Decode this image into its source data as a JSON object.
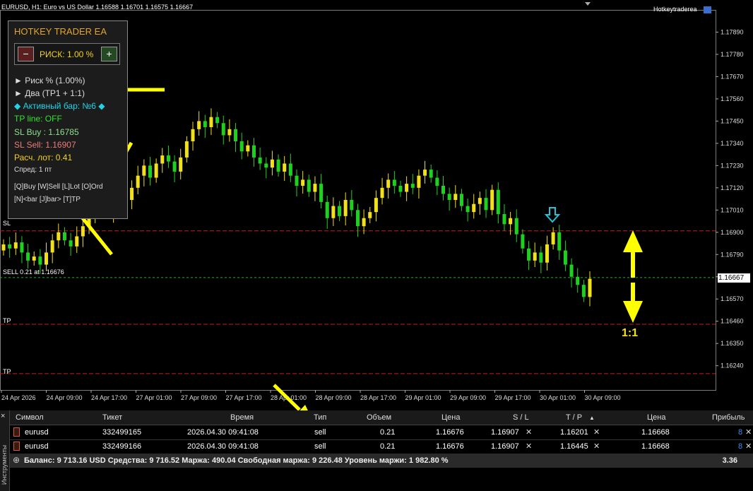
{
  "window": {
    "title": "EURUSD, H1:  Euro vs US Dollar  1.16588 1.16701 1.16575 1.16667",
    "ea_name": "Hotkeytraderea"
  },
  "ea_panel": {
    "title": "HOTKEY TRADER EA",
    "minus_label": "−",
    "plus_label": "+",
    "risk_label": "РИСК: 1.00 %",
    "risk_mode": "► Риск % (1.00%)",
    "tp_mode": "► Два (TP1 + 1:1)",
    "active_bar": "◆ Активный бар: №6 ◆",
    "tp_line": "TP line: OFF",
    "sl_buy": "SL Buy : 1.16785",
    "sl_sell": "SL Sell: 1.16907",
    "calc_lot": "Расч. лот: 0.41",
    "spread": "Спред: 1 пт",
    "hotkeys_1": "[Q]Buy  [W]Sell  [L]Lot  [O]Ord",
    "hotkeys_2": "[N]<bar  [J]bar>  [T]TP"
  },
  "chart_lines": {
    "sl_label": "SL",
    "sell_label": "SELL 0.21 at 1.16676",
    "tp1_label": "TP",
    "tp2_label": "TP",
    "current_price": "1.16667",
    "ratio_label": "1:1"
  },
  "colors": {
    "bull": "#f2e01b",
    "bear": "#1fd11f",
    "sl_line": "#c81e1e",
    "sell_line": "#1fb21f",
    "arrow": "#ffff00",
    "cyan_arrow": "#22c5d5",
    "accent_orange": "#e3a52b"
  },
  "terminal": {
    "close_icon": "×",
    "side_label": "Инструменты",
    "headers": [
      "Символ",
      "Тикет",
      "Время",
      "Тип",
      "Объем",
      "Цена",
      "S / L",
      "T / P",
      "Цена",
      "Прибыль"
    ],
    "sort_indicator": "▲",
    "rows": [
      {
        "symbol": "eurusd",
        "ticket": "332499165",
        "time": "2026.04.30 09:41:08",
        "type": "sell",
        "volume": "0.21",
        "price": "1.16676",
        "sl": "1.16907",
        "tp": "1.16201",
        "cur_price": "1.16668",
        "profit": "8"
      },
      {
        "symbol": "eurusd",
        "ticket": "332499166",
        "time": "2026.04.30 09:41:08",
        "type": "sell",
        "volume": "0.21",
        "price": "1.16676",
        "sl": "1.16907",
        "tp": "1.16445",
        "cur_price": "1.16668",
        "profit": "8"
      }
    ],
    "balance_line": "Баланс: 9 713.16 USD  Средства: 9 716.52  Маржа: 490.04  Свободная маржа: 9 226.48  Уровень маржи: 1 982.80 %",
    "total_profit": "3.36"
  },
  "chart_data": {
    "type": "candlestick",
    "symbol": "EURUSD",
    "timeframe": "H1",
    "ylim": [
      1.1612,
      1.18
    ],
    "y_ticks": [
      "1.17890",
      "1.17780",
      "1.17670",
      "1.17560",
      "1.17450",
      "1.17340",
      "1.17230",
      "1.17120",
      "1.17010",
      "1.16900",
      "1.16790",
      "1.16680",
      "1.16570",
      "1.16460",
      "1.16350",
      "1.16240"
    ],
    "x_ticks": [
      "24 Apr 2026",
      "24 Apr 09:00",
      "24 Apr 17:00",
      "27 Apr 01:00",
      "27 Apr 09:00",
      "27 Apr 17:00",
      "28 Apr 01:00",
      "28 Apr 09:00",
      "28 Apr 17:00",
      "29 Apr 01:00",
      "29 Apr 09:00",
      "29 Apr 17:00",
      "30 Apr 01:00",
      "30 Apr 09:00"
    ],
    "levels": {
      "sl": 1.16907,
      "sell": 1.16676,
      "tp1": 1.16445,
      "tp2": 1.16201
    },
    "closes": [
      1.1684,
      1.1682,
      1.1685,
      1.168,
      1.1676,
      1.1678,
      1.1674,
      1.168,
      1.1686,
      1.169,
      1.1686,
      1.1683,
      1.1688,
      1.1693,
      1.1697,
      1.1703,
      1.1706,
      1.17,
      1.1704,
      1.171,
      1.1706,
      1.1712,
      1.1718,
      1.1723,
      1.1717,
      1.1724,
      1.1728,
      1.1725,
      1.172,
      1.1727,
      1.1735,
      1.1741,
      1.1745,
      1.1742,
      1.1747,
      1.1744,
      1.1738,
      1.1741,
      1.1735,
      1.173,
      1.1733,
      1.1727,
      1.1724,
      1.1722,
      1.1726,
      1.172,
      1.1724,
      1.1718,
      1.1713,
      1.1716,
      1.171,
      1.1714,
      1.1705,
      1.1697,
      1.1703,
      1.1698,
      1.1706,
      1.1701,
      1.1693,
      1.1697,
      1.17,
      1.1707,
      1.1712,
      1.1716,
      1.1713,
      1.171,
      1.1714,
      1.1712,
      1.1718,
      1.1721,
      1.1717,
      1.1713,
      1.1709,
      1.1706,
      1.1709,
      1.1703,
      1.17,
      1.1704,
      1.1707,
      1.1701,
      1.1711,
      1.1699,
      1.1694,
      1.1697,
      1.1689,
      1.1682,
      1.1676,
      1.168,
      1.1675,
      1.1684,
      1.169,
      1.1681,
      1.1674,
      1.1668,
      1.1664,
      1.1658,
      1.1667
    ]
  }
}
